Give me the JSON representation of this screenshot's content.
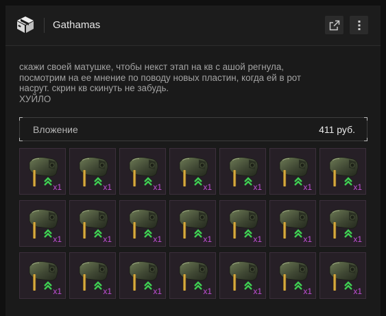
{
  "header": {
    "title": "Gathamas",
    "logo_icon": "cube-box-icon",
    "external_icon": "open-external-icon",
    "more_icon": "vertical-dots-icon"
  },
  "message": {
    "lines": [
      "скажи своей матушке, чтобы некст этап на кв с ашой регнула,",
      "посмотрим на ее мнение по поводу новых пластин, когда ей в рот",
      "насрут. скрин кв скинуть не забудь.",
      "ХУЙЛО"
    ]
  },
  "attachment": {
    "label": "Вложение",
    "value": "411 руб."
  },
  "items": [
    {
      "qty": "x1",
      "icon": "gunner-item-icon"
    },
    {
      "qty": "x1",
      "icon": "gunner-item-icon"
    },
    {
      "qty": "x1",
      "icon": "gunner-item-icon"
    },
    {
      "qty": "x1",
      "icon": "gunner-item-icon"
    },
    {
      "qty": "x1",
      "icon": "gunner-item-icon"
    },
    {
      "qty": "x1",
      "icon": "gunner-item-icon"
    },
    {
      "qty": "x1",
      "icon": "gunner-item-icon"
    },
    {
      "qty": "x1",
      "icon": "gunner-item-icon"
    },
    {
      "qty": "x1",
      "icon": "gunner-item-icon"
    },
    {
      "qty": "x1",
      "icon": "gunner-item-icon"
    },
    {
      "qty": "x1",
      "icon": "gunner-item-icon"
    },
    {
      "qty": "x1",
      "icon": "gunner-item-icon"
    },
    {
      "qty": "x1",
      "icon": "gunner-item-icon"
    },
    {
      "qty": "x1",
      "icon": "gunner-item-icon"
    },
    {
      "qty": "x1",
      "icon": "gunner-item-icon"
    },
    {
      "qty": "x1",
      "icon": "gunner-item-icon"
    },
    {
      "qty": "x1",
      "icon": "gunner-item-icon"
    },
    {
      "qty": "x1",
      "icon": "gunner-item-icon"
    },
    {
      "qty": "x1",
      "icon": "gunner-item-icon"
    },
    {
      "qty": "x1",
      "icon": "gunner-item-icon"
    },
    {
      "qty": "x1",
      "icon": "gunner-item-icon"
    }
  ],
  "colors": {
    "qty_text": "#c24fd8",
    "rank_chevron": "#3fcf52",
    "cell_bg": "#261f26"
  }
}
